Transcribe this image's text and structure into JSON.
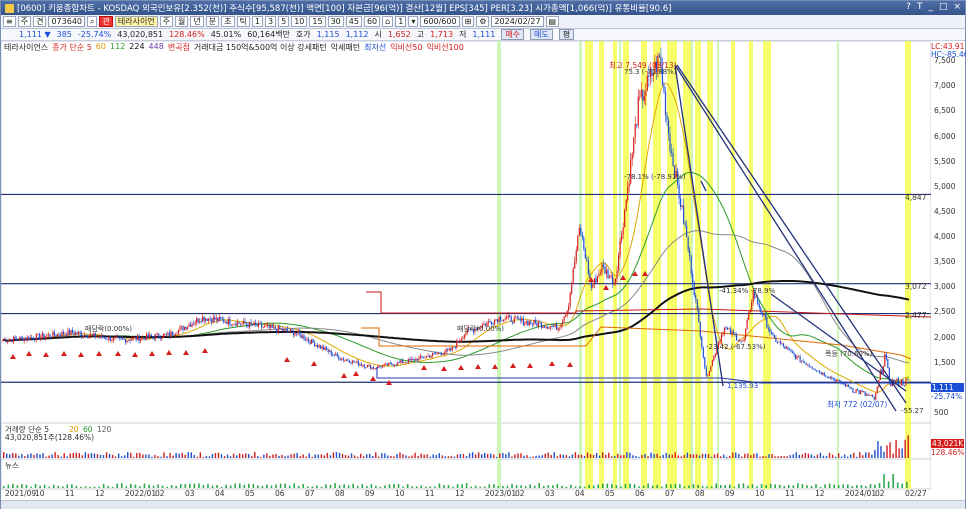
{
  "window": {
    "title": "[0600] 키움종합차트 - KOSDAQ 외국인보유[2.352(천)] 주식수[95,587(천)] 액면[100] 자본금[96(억)] 결산[12월] EPS[345] PER[3.23] 시가총액[1,066(억)] 유통비율[90.6]",
    "buttons": [
      "?",
      "T",
      "_",
      "□",
      "×"
    ]
  },
  "toolbar": {
    "mode": "주",
    "type": "견",
    "code": "073640",
    "company_badge": "관",
    "company": "테라사이언",
    "periods": [
      "주",
      "월",
      "년",
      "분",
      "초",
      "틱"
    ],
    "minutes": [
      "1",
      "3",
      "5",
      "10",
      "15",
      "30",
      "45",
      "60"
    ],
    "count_label": "1",
    "zoom": "600/600",
    "date": "2024/02/27"
  },
  "pricebar": {
    "price": "1,111 ▼",
    "change": "385",
    "change_pct": "-25.74%",
    "volume": "43,020,851",
    "vol_pct": "128.46%",
    "rate": "45.01%",
    "amount": "60,164백만",
    "ask_label": "호가",
    "ask": "1,115",
    "bid": "1,112",
    "open_label": "시",
    "open": "1,652",
    "high_label": "고",
    "high": "1,713",
    "low_label": "저",
    "low": "1,111",
    "buy": "매수",
    "sell": "매도",
    "flat": "평"
  },
  "legend": {
    "name": "테라사이언스",
    "ma": "종가 단순 5",
    "ma2": "60",
    "ma3": "112",
    "ma4": "224",
    "ma5": "448",
    "extra1": "변곡점",
    "extra2": "거래대금 150억&500억 이상 강세패턴",
    "extra3": "악세패턴",
    "extra4": "최저선",
    "extra5": "익비선50",
    "extra6": "익비선100"
  },
  "right_scale": {
    "lc": "LC:43.91",
    "hc": "HC:-85.46",
    "ticks": [
      "7,500",
      "7,000",
      "6,500",
      "6,000",
      "5,500",
      "5,000",
      "4,500",
      "4,000",
      "3,500",
      "3,000",
      "2,500",
      "2,000",
      "1,500",
      "1,000",
      "500"
    ],
    "price_tag": "1,111",
    "pct_tag": "-25.74%",
    "level1": "4,847",
    "level2": "3,072",
    "level3": "2,477",
    "vol_tag": "43,021K",
    "vol_pct": "128.46%"
  },
  "annotations": {
    "high": "최고 7,549 (03/13)",
    "high2": "75.3 (-71.88%)",
    "mid": "-78.1% (-78.91%)",
    "cross": "-41.34%  -78.9%",
    "low_pct": "-23.42 (-67.53%)",
    "level_1135": "1,135.93",
    "low": "최저 772 (02/07)",
    "low_val": "-55.27",
    "right_label": "폭등 (70.60%)",
    "dip1": "매담락(0.00%)",
    "dip2": "매담락(0.00%)"
  },
  "volume_panel": {
    "label": "거래량 단순 5",
    "ma2": "20",
    "ma3": "60",
    "ma4": "120",
    "value": "43,020,851주(128.46%)"
  },
  "news_panel": {
    "label": "뉴스"
  },
  "xaxis": [
    "2021/09",
    "10",
    "11",
    "12",
    "2022/01",
    "02",
    "03",
    "04",
    "05",
    "06",
    "07",
    "08",
    "09",
    "10",
    "11",
    "12",
    "2023/01",
    "02",
    "03",
    "04",
    "05",
    "06",
    "07",
    "08",
    "09",
    "10",
    "11",
    "12",
    "2024/01",
    "02",
    "02/27"
  ],
  "colors": {
    "up": "#d61d1d",
    "down": "#1d4fd6",
    "highlight": "#f4ff3a",
    "ma_black": "#111111"
  }
}
